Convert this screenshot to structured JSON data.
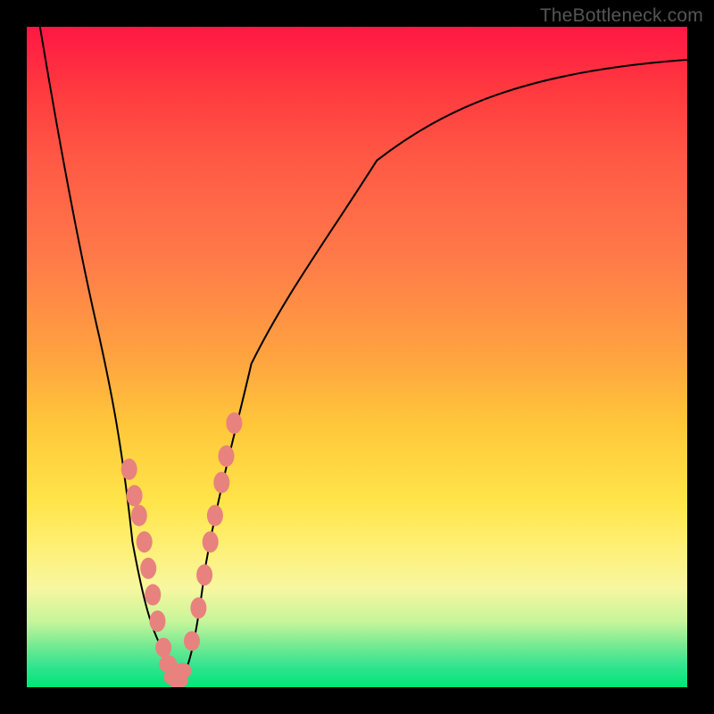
{
  "watermark": "TheBottleneck.com",
  "colors": {
    "frame": "#000000",
    "watermark": "#555555",
    "curve": "#000000",
    "marker": "#e8827e"
  },
  "chart_data": {
    "type": "line",
    "title": "",
    "xlabel": "",
    "ylabel": "",
    "xlim": [
      0,
      100
    ],
    "ylim": [
      0,
      100
    ],
    "annotations": [],
    "series": [
      {
        "name": "bottleneck-curve",
        "x": [
          2,
          5,
          8,
          11,
          14,
          16,
          18,
          19.5,
          21,
          22,
          23,
          24,
          25.5,
          27,
          30,
          34,
          40,
          48,
          58,
          70,
          84,
          100
        ],
        "y": [
          100,
          82,
          66,
          52,
          40,
          31,
          22,
          14,
          7,
          3,
          0.5,
          3,
          9,
          18,
          34,
          49,
          62,
          72,
          80,
          86,
          91,
          95
        ]
      }
    ],
    "markers": {
      "name": "highlight-points",
      "x": [
        15.5,
        16.3,
        17.0,
        17.8,
        18.4,
        19.1,
        19.8,
        20.7,
        21.4,
        22.2,
        22.9,
        23.6,
        25.0,
        26.0,
        26.9,
        27.8,
        28.5,
        29.5,
        30.2,
        31.4
      ],
      "y": [
        33,
        29,
        26,
        22,
        18,
        14,
        10,
        6,
        3.5,
        1.5,
        1.0,
        2.5,
        7,
        12,
        17,
        22,
        26,
        31,
        35,
        40
      ]
    }
  }
}
